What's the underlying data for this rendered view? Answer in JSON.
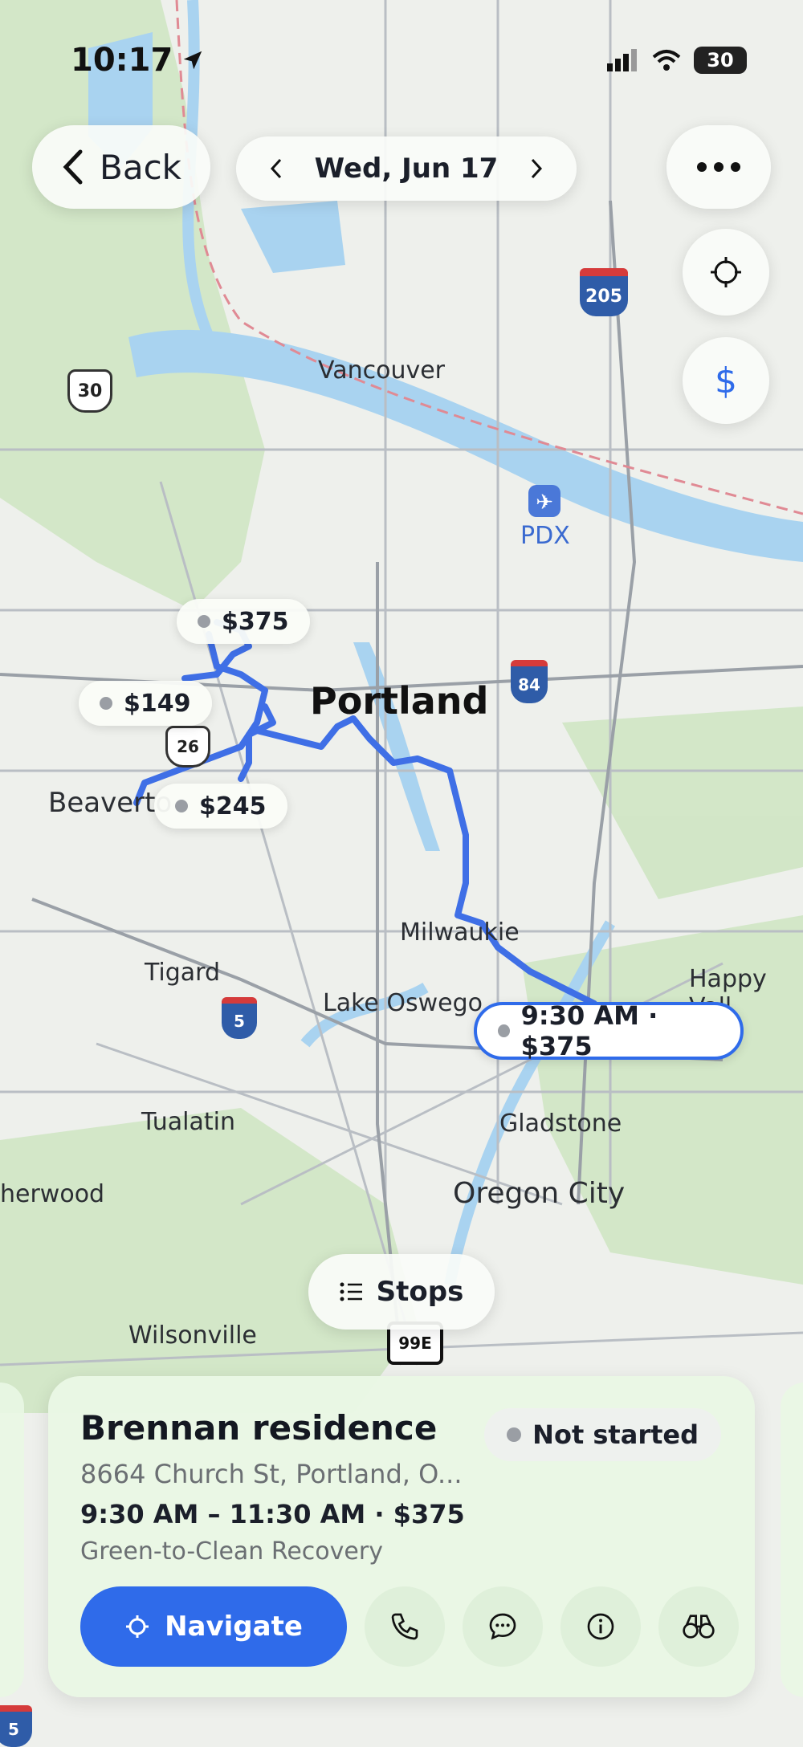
{
  "status_bar": {
    "time": "10:17",
    "battery": "30"
  },
  "header": {
    "back_label": "Back",
    "date": "Wed, Jun 17"
  },
  "map": {
    "places": {
      "vancouver": "Vancouver",
      "pdx": "PDX",
      "portland": "Portland",
      "beaverton": "Beaverto",
      "milwaukie": "Milwaukie",
      "tigard": "Tigard",
      "lake_oswego": "Lake Oswego",
      "happy_valley": "Happy Vall",
      "tualatin": "Tualatin",
      "gladstone": "Gladstone",
      "sherwood": "herwood",
      "oregon_city": "Oregon City",
      "wilsonville": "Wilsonville"
    },
    "shields": {
      "i205": "205",
      "us30": "30",
      "i84": "84",
      "us26": "26",
      "i5": "5",
      "or99e": "99E",
      "i5_bottom": "5"
    },
    "price_labels": [
      "$375",
      "$149",
      "$245"
    ],
    "active_label": "9:30 AM · $375"
  },
  "stops_button": "Stops",
  "card": {
    "name": "Brennan residence",
    "status": "Not started",
    "address": "8664 Church St, Portland, O...",
    "time": "9:30 AM – 11:30 AM  ·  $375",
    "company": "Green-to-Clean Recovery",
    "navigate_label": "Navigate"
  },
  "colors": {
    "accent": "#2f6bea",
    "route": "#3f6fe6",
    "card_bg": "#e9f7e4"
  }
}
